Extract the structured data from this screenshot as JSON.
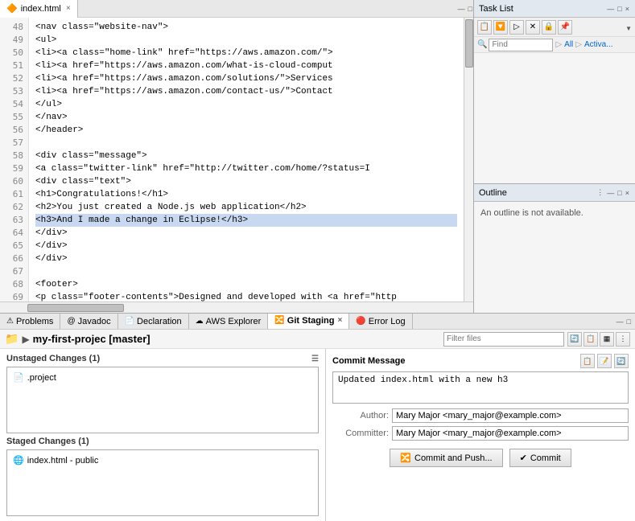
{
  "editor": {
    "tab_label": "index.html",
    "tab_close": "×",
    "lines": [
      {
        "num": "48",
        "code": "    <nav class=\"website-nav\">",
        "highlighted": false
      },
      {
        "num": "49",
        "code": "        <ul>",
        "highlighted": false
      },
      {
        "num": "50",
        "code": "            <li><a class=\"home-link\" href=\"https://aws.amazon.com/\">",
        "highlighted": false
      },
      {
        "num": "51",
        "code": "            <li><a href=\"https://aws.amazon.com/what-is-cloud-comput",
        "highlighted": false
      },
      {
        "num": "52",
        "code": "            <li><a href=\"https://aws.amazon.com/solutions/\">Services",
        "highlighted": false
      },
      {
        "num": "53",
        "code": "            <li><a href=\"https://aws.amazon.com/contact-us/\">Contact",
        "highlighted": false
      },
      {
        "num": "54",
        "code": "        </ul>",
        "highlighted": false
      },
      {
        "num": "55",
        "code": "    </nav>",
        "highlighted": false
      },
      {
        "num": "56",
        "code": "</header>",
        "highlighted": false
      },
      {
        "num": "57",
        "code": "",
        "highlighted": false
      },
      {
        "num": "58",
        "code": "    <div class=\"message\">",
        "highlighted": false
      },
      {
        "num": "59",
        "code": "        <a class=\"twitter-link\" href=\"http://twitter.com/home/?status=I",
        "highlighted": false
      },
      {
        "num": "60",
        "code": "        <div class=\"text\">",
        "highlighted": false
      },
      {
        "num": "61",
        "code": "            <h1>Congratulations!</h1>",
        "highlighted": false
      },
      {
        "num": "62",
        "code": "            <h2>You just created a Node.js web application</h2>",
        "highlighted": false
      },
      {
        "num": "63",
        "code": "            <h3>And I made a change in Eclipse!</h3>",
        "highlighted": true
      },
      {
        "num": "64",
        "code": "        </div>",
        "highlighted": false
      },
      {
        "num": "65",
        "code": "    </div>",
        "highlighted": false
      },
      {
        "num": "66",
        "code": "</div>",
        "highlighted": false
      },
      {
        "num": "67",
        "code": "",
        "highlighted": false
      },
      {
        "num": "68",
        "code": "<footer>",
        "highlighted": false
      },
      {
        "num": "69",
        "code": "    <p class=\"footer-contents\">Designed and developed with <a href=\"http",
        "highlighted": false
      }
    ]
  },
  "task_list": {
    "title": "Task List",
    "close": "×",
    "filter_placeholder": "Find",
    "filter_all": "All",
    "filter_activa": "Activa...",
    "toolbar_icons": [
      "⬇",
      "⬆",
      "🔽",
      "▷",
      "✕",
      "🔒",
      "📌"
    ]
  },
  "outline": {
    "title": "Outline",
    "empty_message": "An outline is not available."
  },
  "bottom_tabs": {
    "tabs": [
      {
        "label": "Problems",
        "icon": "⚠",
        "active": false
      },
      {
        "label": "Javadoc",
        "icon": "@",
        "active": false
      },
      {
        "label": "Declaration",
        "icon": "📄",
        "active": false
      },
      {
        "label": "AWS Explorer",
        "icon": "☁",
        "active": false
      },
      {
        "label": "Git Staging",
        "icon": "🔀",
        "active": true
      },
      {
        "label": "Error Log",
        "icon": "🔴",
        "active": false
      }
    ]
  },
  "git": {
    "project_name": "my-first-projec [master]",
    "filter_placeholder": "Filter files",
    "unstaged_header": "Unstaged Changes (1)",
    "staged_header": "Staged Changes (1)",
    "unstaged_files": [
      {
        "name": ".project",
        "icon": "📄"
      }
    ],
    "staged_files": [
      {
        "name": "index.html - public",
        "icon": "🌐"
      }
    ],
    "commit_header": "Commit Message",
    "commit_message": "Updated index.html with a new h3",
    "author_label": "Author:",
    "author_value": "Mary Major <mary_major@example.com>",
    "committer_label": "Committer:",
    "committer_value": "Mary Major <mary_major@example.com>",
    "commit_push_label": "Commit and Push...",
    "commit_label": "Commit"
  }
}
